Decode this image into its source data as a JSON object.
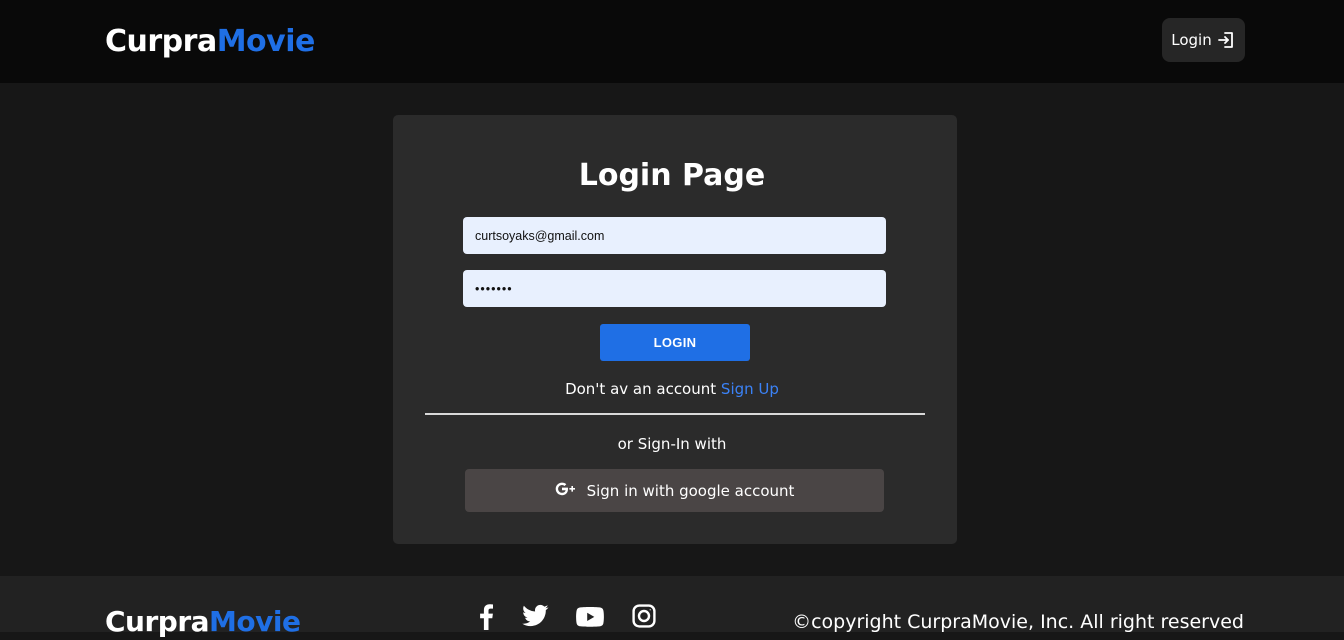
{
  "header": {
    "brand_part1": "Curpra",
    "brand_part2": "Movie",
    "login_label": "Login",
    "login_icon": "login-arrow-icon"
  },
  "login_form": {
    "title": "Login Page",
    "email_value": "curtsoyaks@gmail.com",
    "password_value": "•••••••",
    "submit_label": "LOGIN",
    "no_account_text": "Don't av an account",
    "signup_link": "Sign Up",
    "alt_signin_text": "or Sign-In with",
    "google_label": "Sign in with google account",
    "google_icon": "google-plus-icon"
  },
  "footer": {
    "brand_part1": "Curpra",
    "brand_part2": "Movie",
    "social_icons": [
      "facebook-icon",
      "twitter-icon",
      "youtube-icon",
      "instagram-icon"
    ],
    "copyright": "©copyright CurpraMovie, Inc. All right reserved"
  },
  "colors": {
    "accent": "#1f6fe5",
    "header_bg": "#090909",
    "page_bg": "#171717",
    "card_bg": "#2b2b2b",
    "input_bg": "#e8f0fe",
    "google_btn_bg": "#4a4545",
    "footer_bg": "#222222"
  }
}
